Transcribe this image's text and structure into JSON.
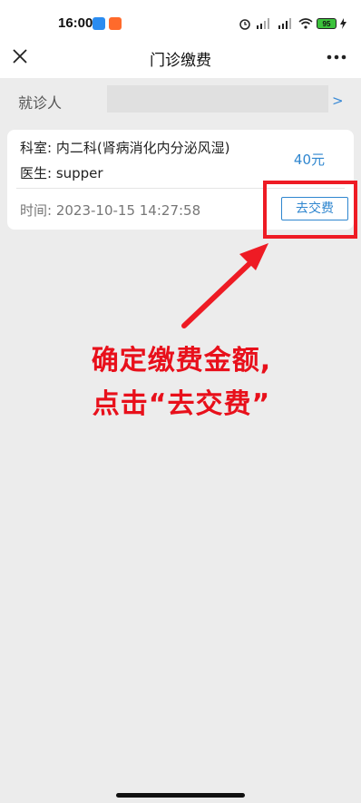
{
  "status_bar": {
    "time": "16:00",
    "battery": "95"
  },
  "title_bar": {
    "title": "门诊缴费",
    "close_icon": "close-icon",
    "more_icon": "more-icon"
  },
  "patient": {
    "label": "就诊人",
    "value": "",
    "arrow": ">"
  },
  "record": {
    "department": "科室: 内二科(肾病消化内分泌风湿)",
    "doctor": "医生: supper",
    "amount": "40元",
    "time": "时间: 2023-10-15 14:27:58",
    "pay_button_label": "去交费"
  },
  "annotation": {
    "line1": "确定缴费金额,",
    "line2": "点击“去交费”",
    "color": "#ee1b24"
  },
  "colors": {
    "accent": "#2f86cf",
    "background": "#ececec"
  }
}
